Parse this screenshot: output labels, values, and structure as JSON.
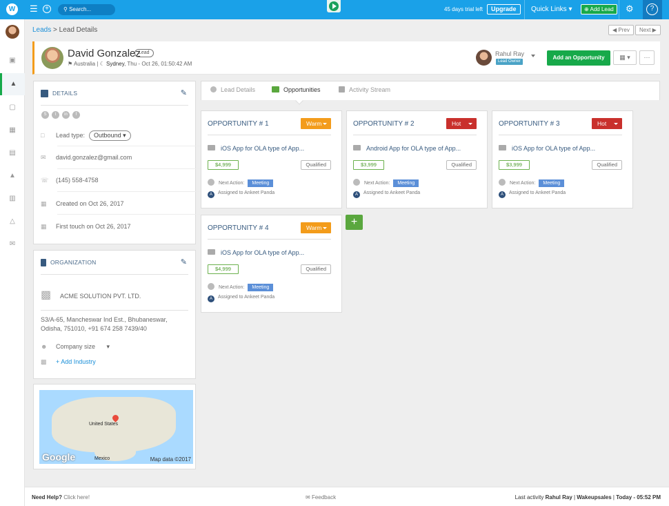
{
  "topbar": {
    "logo": "W",
    "search_placeholder": "Search...",
    "trial_text": "45 days trial left",
    "upgrade_label": "Upgrade",
    "quick_links_label": "Quick Links",
    "add_lead_label": "Add Lead",
    "help_label": "?"
  },
  "breadcrumb": {
    "parent": "Leads",
    "separator": " > ",
    "current": "Lead Details"
  },
  "pager": {
    "prev": "Prev",
    "next": "Next"
  },
  "lead": {
    "name": "David Gonzalez",
    "badge": "Lead",
    "country": "Australia",
    "city": "Sydney",
    "local_time": "Thu - Oct 26, 01:50:42 AM",
    "owner_name": "Rahul Ray",
    "owner_role": "Lead Owner",
    "add_opportunity_label": "Add an Opportunity",
    "more_label": "···"
  },
  "details": {
    "title": "DETAILS",
    "lead_type_label": "Lead type:",
    "lead_type_value": "Outbound",
    "email": "david.gonzalez@gmail.com",
    "phone": "(145) 558-4758",
    "created": "Created on Oct 26, 2017",
    "first_touch": "First touch on Oct 26, 2017"
  },
  "organization": {
    "title": "ORGANIZATION",
    "name": "ACME SOLUTION PVT. LTD.",
    "address_line1": "S3/A-65, Mancheswar Ind Est., Bhubaneswar,",
    "address_line2": "Odisha, 751010, +91 674 258 7439/40",
    "company_size_label": "Company size",
    "add_industry_label": "+ Add Industry"
  },
  "map": {
    "label_us": "United States",
    "label_mexico": "Mexico",
    "google": "Google",
    "map_data": "Map data ©2017"
  },
  "tabs": [
    {
      "label": "Lead Details"
    },
    {
      "label": "Opportunities"
    },
    {
      "label": "Activity Stream"
    }
  ],
  "opportunities": [
    {
      "title": "OPPORTUNITY # 1",
      "tag": "Warm",
      "name": "iOS App for OLA type of App...",
      "amount": "$4,999",
      "stage": "Qualified",
      "next_action_label": "Next Action:",
      "next_action": "Meeting",
      "assigned": "Assigned to Ankeet Panda"
    },
    {
      "title": "OPPORTUNITY # 2",
      "tag": "Hot",
      "name": "Android App for OLA type of App...",
      "amount": "$3,999",
      "stage": "Qualified",
      "next_action_label": "Next Action:",
      "next_action": "Meeting",
      "assigned": "Assigned to Ankeet Panda"
    },
    {
      "title": "OPPORTUNITY # 3",
      "tag": "Hot",
      "name": "iOS App for OLA type of App...",
      "amount": "$3,999",
      "stage": "Qualified",
      "next_action_label": "Next Action:",
      "next_action": "Meeting",
      "assigned": "Assigned to Ankeet Panda"
    },
    {
      "title": "OPPORTUNITY # 4",
      "tag": "Warm",
      "name": "iOS App for OLA type of App...",
      "amount": "$4,999",
      "stage": "Qualified",
      "next_action_label": "Next Action:",
      "next_action": "Meeting",
      "assigned": "Assigned to Ankeet Panda"
    }
  ],
  "add_card_label": "+",
  "footer": {
    "need_help": "Need Help?",
    "click_here": "Click here!",
    "feedback": "Feedback",
    "last_activity_label": "Last activity",
    "last_activity_user": "Rahul Ray",
    "separator": " | ",
    "company": "Wakeupsales",
    "time": "Today - 05:52 PM"
  },
  "colors": {
    "topbar": "#1aa1e8",
    "accent_green": "#17a94a",
    "warm": "#f39c1b",
    "hot": "#c9302c",
    "title_blue": "#375a7f"
  }
}
